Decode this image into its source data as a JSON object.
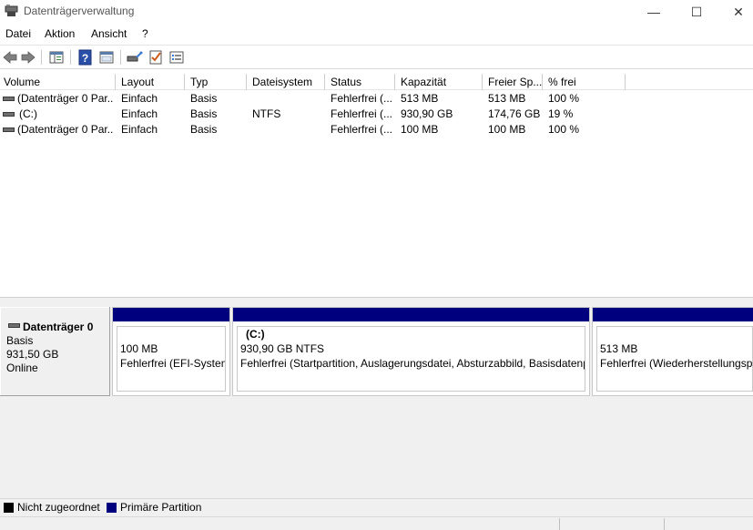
{
  "window": {
    "title": "Datenträgerverwaltung",
    "minimize": "—",
    "maximize": "☐",
    "close": "✕"
  },
  "menu": [
    "Datei",
    "Aktion",
    "Ansicht",
    "?"
  ],
  "toolbar": {
    "buttons": [
      "back-icon",
      "forward-icon",
      "console-tree-icon",
      "help-icon",
      "properties-icon",
      "connect-icon",
      "check-icon",
      "list-icon"
    ]
  },
  "volume_table": {
    "headers": [
      "Volume",
      "Layout",
      "Typ",
      "Dateisystem",
      "Status",
      "Kapazität",
      "Freier Sp...",
      "% frei"
    ],
    "rows": [
      [
        "(Datenträger 0 Par...",
        "Einfach",
        "Basis",
        "",
        "Fehlerfrei (...",
        "513 MB",
        "513 MB",
        "100 %"
      ],
      [
        "(C:)",
        "Einfach",
        "Basis",
        "NTFS",
        "Fehlerfrei (...",
        "930,90 GB",
        "174,76 GB",
        "19 %"
      ],
      [
        "(Datenträger 0 Par...",
        "Einfach",
        "Basis",
        "",
        "Fehlerfrei (...",
        "100 MB",
        "100 MB",
        "100 %"
      ]
    ]
  },
  "disk": {
    "name": "Datenträger 0",
    "type": "Basis",
    "size": "931,50 GB",
    "state": "Online",
    "partitions": [
      {
        "title": "",
        "size": "100 MB",
        "status": "Fehlerfrei (EFI-Systempartition)"
      },
      {
        "title": "(C:)",
        "size": "930,90 GB NTFS",
        "status": "Fehlerfrei (Startpartition, Auslagerungsdatei, Absturzabbild, Basisdatenpartition)"
      },
      {
        "title": "",
        "size": "513 MB",
        "status": "Fehlerfrei (Wiederherstellungspartition)"
      }
    ]
  },
  "legend": {
    "unallocated": "Nicht zugeordnet",
    "primary": "Primäre Partition",
    "unallocated_color": "#000000",
    "primary_color": "#00007f"
  }
}
